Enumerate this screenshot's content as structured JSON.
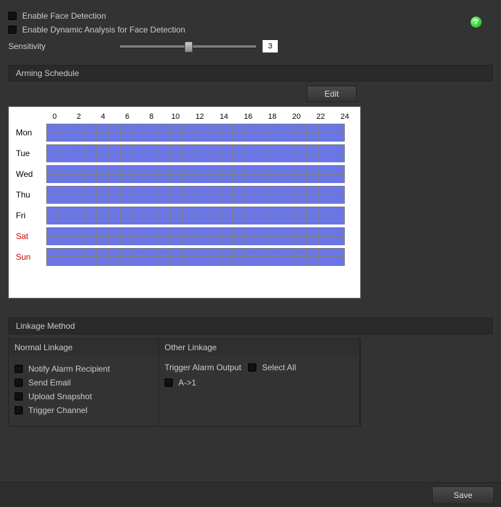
{
  "options": {
    "enable_face_detection_label": "Enable Face Detection",
    "enable_dynamic_label": "Enable Dynamic Analysis for Face Detection",
    "sensitivity_label": "Sensitivity",
    "sensitivity_value": "3",
    "sensitivity_min": 0,
    "sensitivity_max": 5,
    "sensitivity_percent": 50
  },
  "help_icon": "?",
  "arming": {
    "header": "Arming Schedule",
    "edit_label": "Edit",
    "hours": [
      "0",
      "2",
      "4",
      "6",
      "8",
      "10",
      "12",
      "14",
      "16",
      "18",
      "20",
      "22",
      "24"
    ],
    "days": [
      {
        "label": "Mon",
        "weekend": false
      },
      {
        "label": "Tue",
        "weekend": false
      },
      {
        "label": "Wed",
        "weekend": false
      },
      {
        "label": "Thu",
        "weekend": false
      },
      {
        "label": "Fri",
        "weekend": false
      },
      {
        "label": "Sat",
        "weekend": true
      },
      {
        "label": "Sun",
        "weekend": true
      }
    ]
  },
  "linkage": {
    "header": "Linkage Method",
    "normal_header": "Normal Linkage",
    "other_header": "Other Linkage",
    "normal_items": [
      "Notify Alarm Recipient",
      "Send Email",
      "Upload Snapshot",
      "Trigger Channel"
    ],
    "trigger_alarm_label": "Trigger Alarm Output",
    "select_all_label": "Select All",
    "other_items": [
      "A->1"
    ]
  },
  "footer": {
    "save_label": "Save"
  }
}
